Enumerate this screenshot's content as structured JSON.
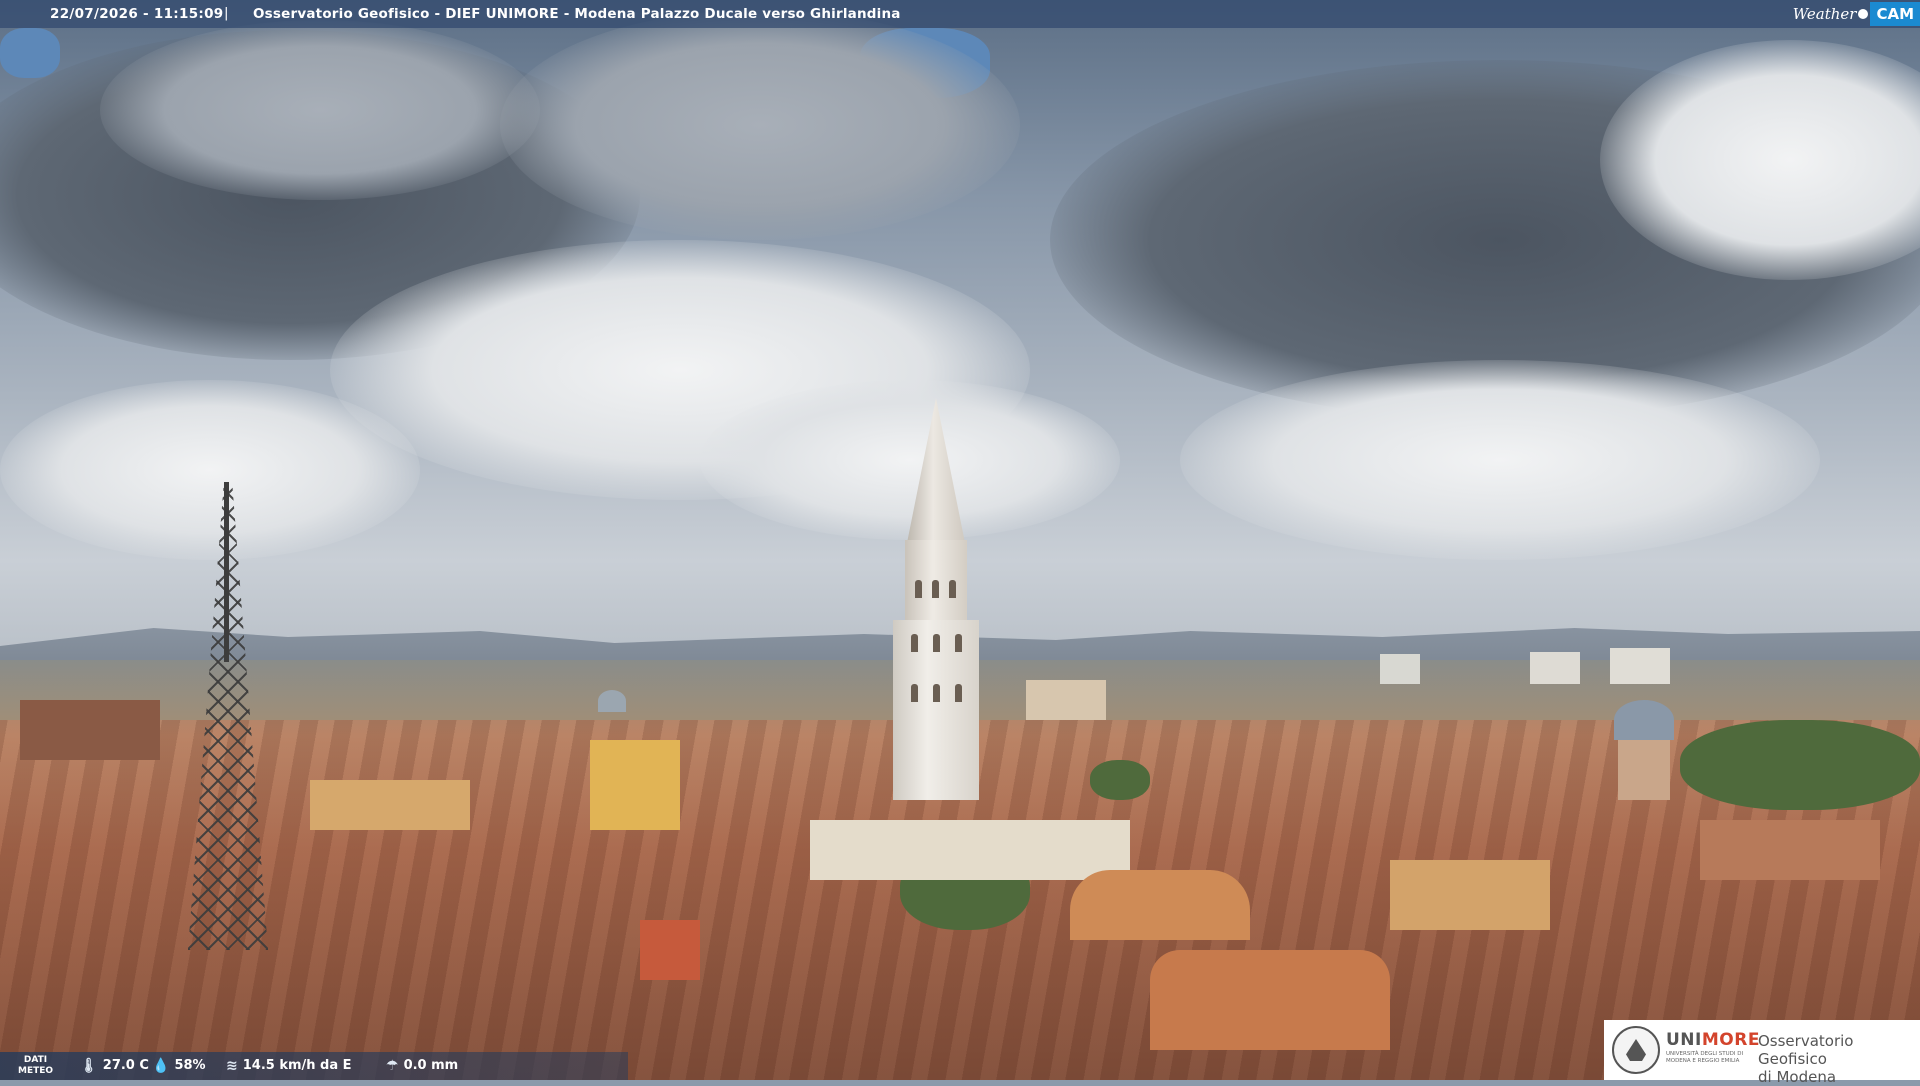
{
  "header": {
    "timestamp": "22/07/2026 - 11:15:09",
    "separator": "|",
    "title": "Osservatorio Geofisico - DIEF UNIMORE - Modena Palazzo Ducale verso Ghirlandina"
  },
  "brand": {
    "weather": "Weather",
    "cam": "CAM"
  },
  "weather_strip": {
    "label": [
      "DATI",
      "METEO"
    ],
    "temperature": "27.0 C",
    "humidity": "58%",
    "wind": "14.5 km/h da E",
    "rain": "0.0 mm",
    "icons": [
      "thermometer-icon",
      "humidity-icon",
      "wind-icon",
      "rain-icon"
    ]
  },
  "logo": {
    "uni": "UNI",
    "more": "MORE",
    "subtitle": "UNIVERSITÀ DEGLI STUDI DI MODENA E REGGIO EMILIA",
    "line1": "Osservatorio Geofisico",
    "line2": "di Modena"
  },
  "colors": {
    "banner": "#30486e",
    "cam_badge": "#1b8ad1",
    "unimore_accent": "#d3442c"
  }
}
